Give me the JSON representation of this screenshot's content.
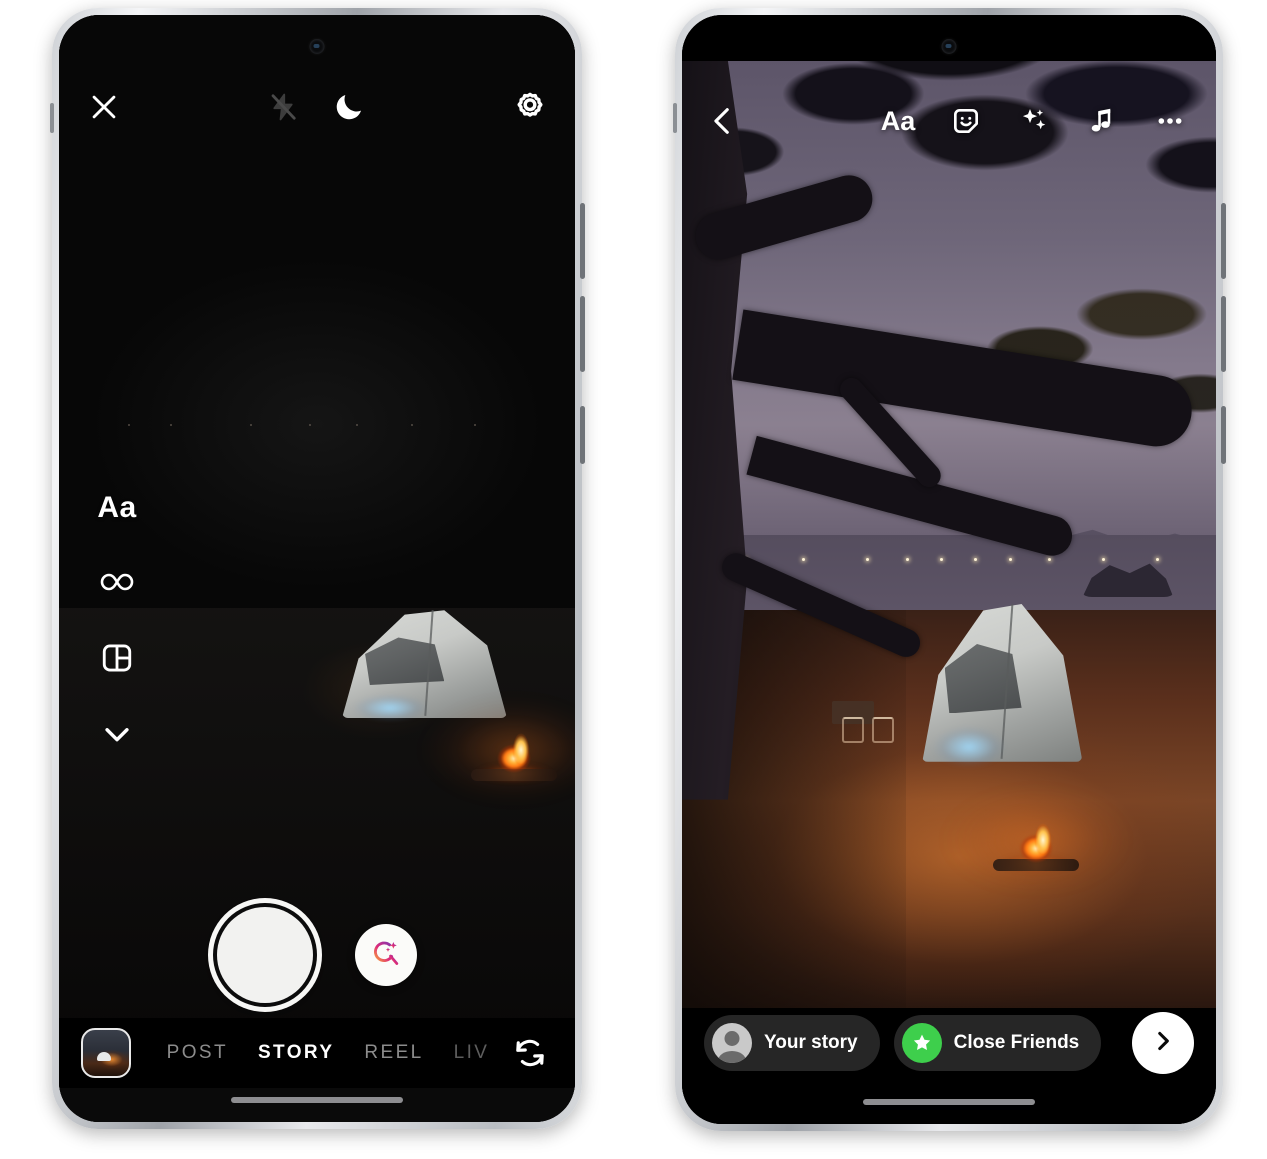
{
  "left_phone": {
    "screen_name": "Instagram camera — Story mode",
    "topbar": {
      "close_label": "close-icon",
      "flash_label": "flash-off-icon",
      "night_mode_label": "night-mode-moon-icon",
      "settings_label": "settings-gear-icon"
    },
    "tools": [
      {
        "id": "text",
        "label": "Aa",
        "icon": "text-icon"
      },
      {
        "id": "boomerang",
        "label": "",
        "icon": "infinity-icon"
      },
      {
        "id": "layout",
        "label": "",
        "icon": "layout-icon"
      },
      {
        "id": "more",
        "label": "",
        "icon": "chevron-down-icon"
      }
    ],
    "capture": {
      "shutter_label": "shutter-button",
      "ai_label": "ai-search-button"
    },
    "modes": [
      {
        "label": "POST",
        "active": false,
        "clipped": false
      },
      {
        "label": "STORY",
        "active": true,
        "clipped": false
      },
      {
        "label": "REEL",
        "active": false,
        "clipped": false
      },
      {
        "label": "LIV",
        "active": false,
        "clipped": true
      }
    ],
    "gallery_label": "gallery-thumbnail",
    "flip_label": "flip-camera-icon"
  },
  "right_phone": {
    "screen_name": "Instagram story editor — captured photo",
    "topbar": {
      "back_label": "back-chevron-icon",
      "tools": [
        {
          "id": "text",
          "label": "Aa",
          "icon": "text-icon"
        },
        {
          "id": "sticker",
          "label": "",
          "icon": "sticker-smiley-icon"
        },
        {
          "id": "effects",
          "label": "",
          "icon": "sparkles-icon"
        },
        {
          "id": "music",
          "label": "",
          "icon": "music-note-icon"
        },
        {
          "id": "more",
          "label": "",
          "icon": "more-options-icon"
        }
      ]
    },
    "bottom": {
      "your_story_label": "Your story",
      "close_friends_label": "Close Friends",
      "next_label": "next-chevron-icon"
    }
  },
  "colors": {
    "close_friends_green": "#3ecf4c",
    "pill_background": "#262626",
    "accent_white": "#ffffff",
    "gradient_start": "#f58529",
    "gradient_mid": "#dd2a7b",
    "gradient_end": "#8134af"
  }
}
